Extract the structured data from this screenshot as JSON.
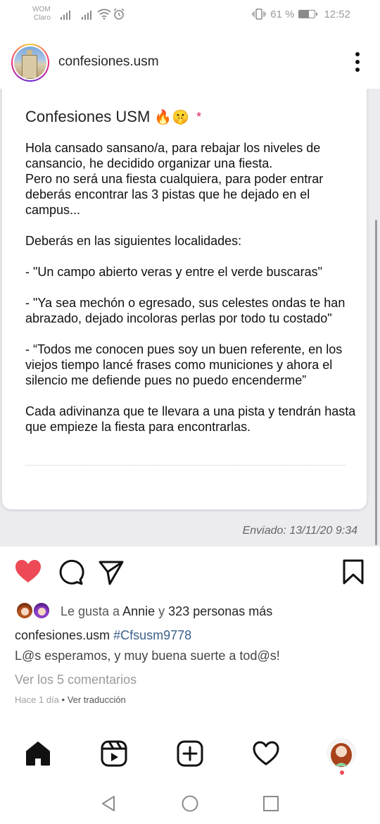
{
  "status_bar": {
    "carrier_1": "WOM",
    "carrier_2": "Claro",
    "battery_text": "61 %",
    "battery_level": 0.61,
    "time": "12:52"
  },
  "post": {
    "username": "confesiones.usm",
    "card": {
      "title": "Confesiones USM",
      "title_emojis": "🔥🤫",
      "title_mark": "*",
      "body": "Hola cansado sansano/a, para rebajar los niveles de cansancio, he decidido organizar una fiesta.\nPero no será una fiesta cualquiera, para poder entrar deberás encontrar las 3 pistas que he dejado en el campus...\n\nDeberás en las siguientes localidades:\n\n- \"Un campo abierto veras y entre el verde buscaras\"\n\n- \"Ya sea mechón o egresado, sus celestes ondas te han abrazado, dejado incoloras perlas por todo tu costado\"\n\n- “Todos me conocen pues soy un buen referente, en los viejos tiempo lancé frases como municiones y ahora el silencio me defiende pues no puedo encenderme”\n\nCada adivinanza que te llevara a una pista y tendrán hasta que empieze la fiesta para encontrarlas.",
      "sent_label": "Enviado: 13/11/20 9:34"
    },
    "likes": {
      "prefix": "Le gusta a",
      "first_user": "Annie",
      "connector": "y",
      "others": "323 personas más"
    },
    "caption": {
      "username": "confesiones.usm",
      "hashtag": "#Cfsusm9778",
      "text": "L@s esperamos, y muy buena suerte a tod@s!"
    },
    "view_comments": "Ver los 5 comentarios",
    "time_ago": "Hace 1 día",
    "separator": "•",
    "translate": "Ver traducción"
  },
  "colors": {
    "like_red": "#ed4956",
    "link_blue": "#3b5f8a",
    "background_image": "#ebebf0"
  },
  "icons": {
    "like": "heart-filled-icon",
    "comment": "comment-icon",
    "share": "paper-plane-icon",
    "save": "bookmark-icon",
    "nav": [
      "home-icon",
      "reels-icon",
      "add-post-icon",
      "activity-heart-icon",
      "profile-avatar"
    ],
    "system": [
      "back-triangle-icon",
      "home-circle-icon",
      "recents-square-icon"
    ]
  }
}
